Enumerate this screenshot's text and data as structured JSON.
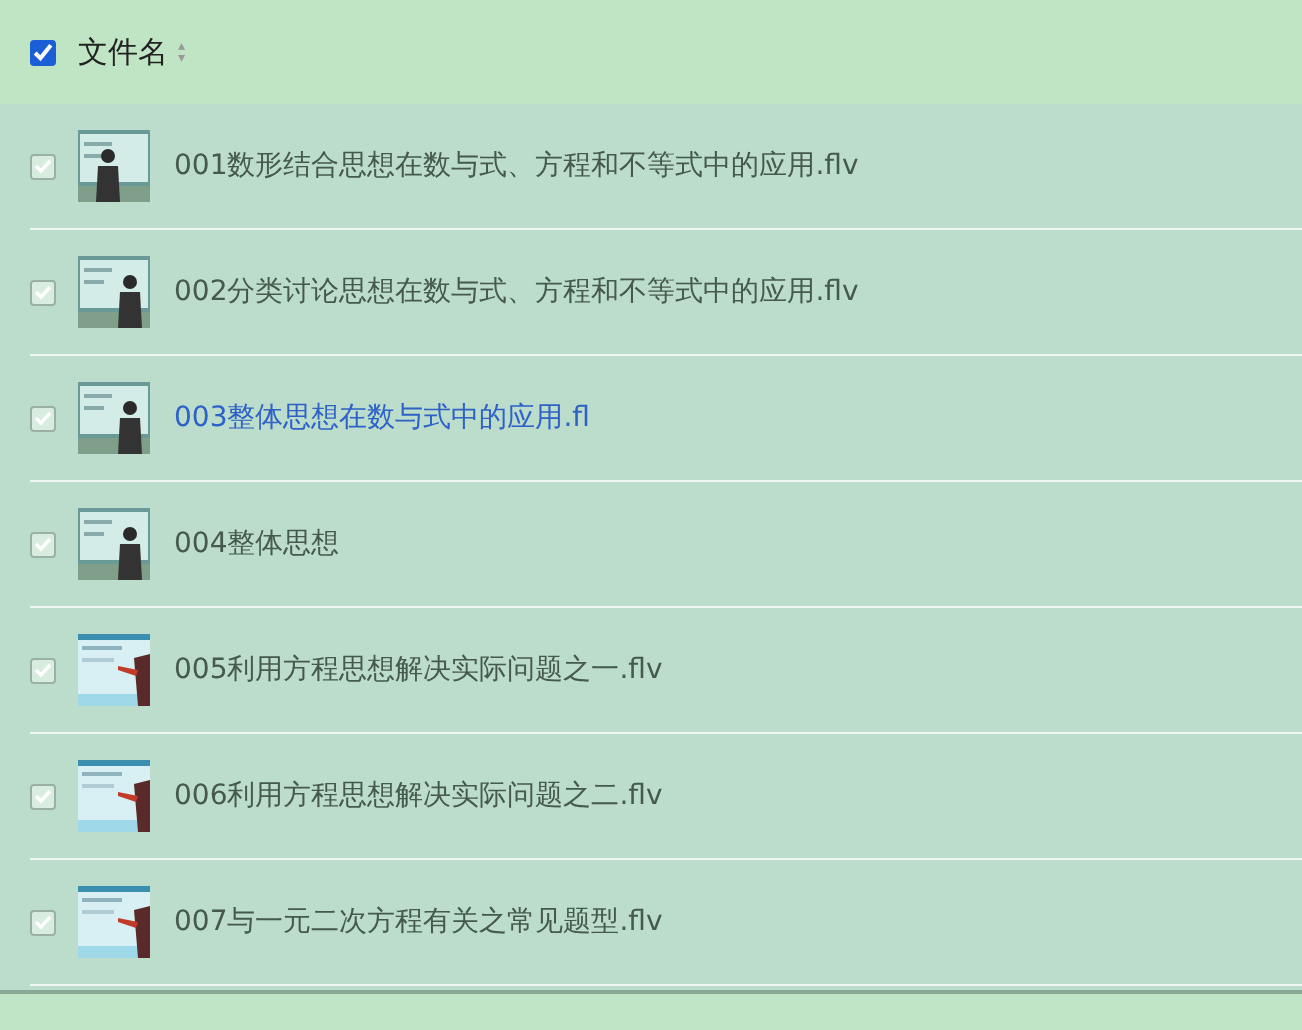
{
  "header": {
    "checked": true,
    "label": "文件名",
    "sort_icon": "▴▾"
  },
  "files": [
    {
      "name": "001数形结合思想在数与式、方程和不等式中的应用.flv",
      "checked": true,
      "highlighted": false
    },
    {
      "name": "002分类讨论思想在数与式、方程和不等式中的应用.flv",
      "checked": true,
      "highlighted": false
    },
    {
      "name": "003整体思想在数与式中的应用.fl",
      "checked": true,
      "highlighted": true
    },
    {
      "name": "004整体思想",
      "checked": true,
      "highlighted": false
    },
    {
      "name": "005利用方程思想解决实际问题之一.flv",
      "checked": true,
      "highlighted": false
    },
    {
      "name": "006利用方程思想解决实际问题之二.flv",
      "checked": true,
      "highlighted": false
    },
    {
      "name": "007与一元二次方程有关之常见题型.flv",
      "checked": true,
      "highlighted": false
    }
  ]
}
